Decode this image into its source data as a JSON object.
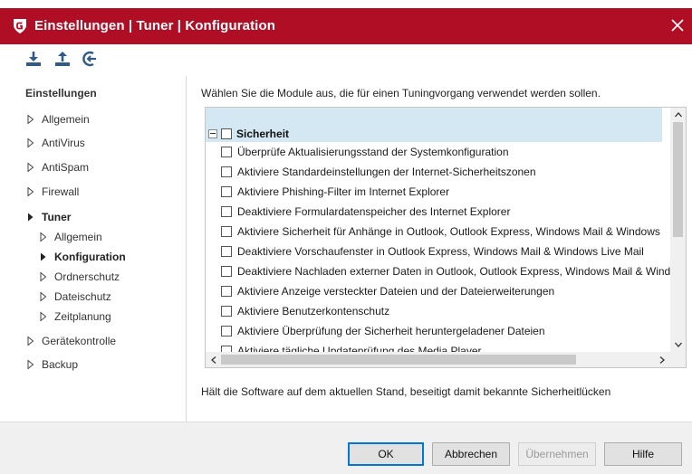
{
  "window": {
    "title": "Einstellungen | Tuner | Konfiguration",
    "brand_color": "#b00e24",
    "logo_icon": "gdata-shield-icon",
    "close_icon": "close-icon"
  },
  "toolbar": {
    "icons": [
      "import-icon",
      "export-icon",
      "reset-icon"
    ]
  },
  "sidebar": {
    "heading": "Einstellungen",
    "items": [
      {
        "label": "Allgemein"
      },
      {
        "label": "AntiVirus"
      },
      {
        "label": "AntiSpam"
      },
      {
        "label": "Firewall"
      },
      {
        "label": "Tuner",
        "expanded": true
      },
      {
        "label": "Allgemein"
      },
      {
        "label": "Konfiguration",
        "selected": true
      },
      {
        "label": "Ordnerschutz"
      },
      {
        "label": "Dateischutz"
      },
      {
        "label": "Zeitplanung"
      },
      {
        "label": "Gerätekontrolle"
      },
      {
        "label": "Backup"
      }
    ]
  },
  "main": {
    "instruction": "Wählen Sie die Module aus, die für einen Tuningvorgang verwendet werden sollen.",
    "group": {
      "label": "Sicherheit",
      "checked": false
    },
    "options": [
      {
        "label": "Überprüfe Aktualisierungsstand der Systemkonfiguration",
        "checked": false
      },
      {
        "label": "Aktiviere Standardeinstellungen der Internet-Sicherheitszonen",
        "checked": false
      },
      {
        "label": "Aktiviere Phishing-Filter im Internet Explorer",
        "checked": false
      },
      {
        "label": "Deaktiviere Formulardatenspeicher des Internet Explorer",
        "checked": false
      },
      {
        "label": "Aktiviere Sicherheit für Anhänge in Outlook, Outlook Express, Windows Mail & Windows",
        "checked": false
      },
      {
        "label": "Deaktiviere Vorschaufenster in Outlook Express, Windows Mail & Windows Live Mail",
        "checked": false
      },
      {
        "label": "Deaktiviere Nachladen externer Daten in Outlook, Outlook Express, Windows Mail & Wind",
        "checked": false
      },
      {
        "label": "Aktiviere Anzeige versteckter Dateien und der Dateierweiterungen",
        "checked": false
      },
      {
        "label": "Aktiviere Benutzerkontenschutz",
        "checked": false
      },
      {
        "label": "Aktiviere Überprüfung der Sicherheit heruntergeladener Dateien",
        "checked": false
      },
      {
        "label": "Aktiviere tägliche Updateprüfung des Media Player",
        "checked": false
      }
    ],
    "description": "Hält die Software auf dem aktuellen Stand, beseitigt damit bekannte Sicherheitlücken"
  },
  "buttons": {
    "ok": "OK",
    "cancel": "Abbrechen",
    "apply": "Übernehmen",
    "help": "Hilfe"
  }
}
